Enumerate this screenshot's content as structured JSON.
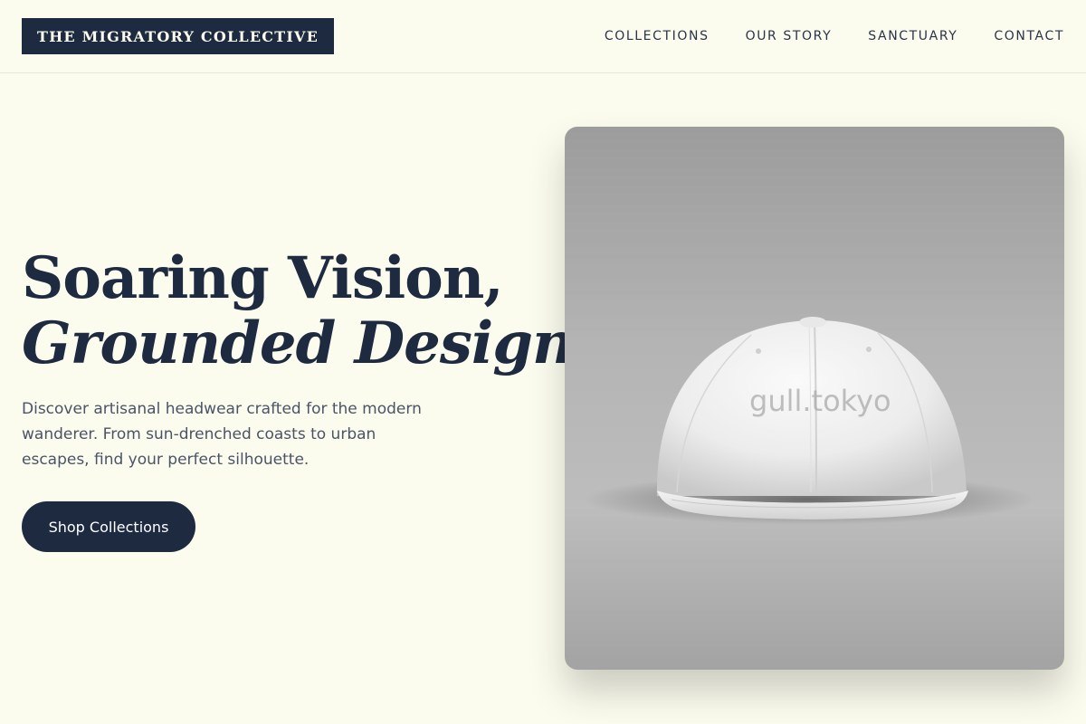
{
  "header": {
    "brand": "THE MIGRATORY COLLECTIVE",
    "nav": [
      {
        "label": "COLLECTIONS"
      },
      {
        "label": "OUR STORY"
      },
      {
        "label": "SANCTUARY"
      },
      {
        "label": "CONTACT"
      }
    ]
  },
  "hero": {
    "title_line1": "Soaring Vision,",
    "title_line2": "Grounded Design.",
    "description": "Discover artisanal headwear crafted for the modern wanderer. From sun-drenched coasts to urban escapes, find your perfect silhouette.",
    "cta_label": "Shop Collections"
  },
  "product_image": {
    "subject": "white baseball cap on grey backdrop",
    "watermark": "gull.tokyo"
  },
  "colors": {
    "background": "#fbfcee",
    "navy": "#1e2a40",
    "body_text": "#4a5466"
  }
}
